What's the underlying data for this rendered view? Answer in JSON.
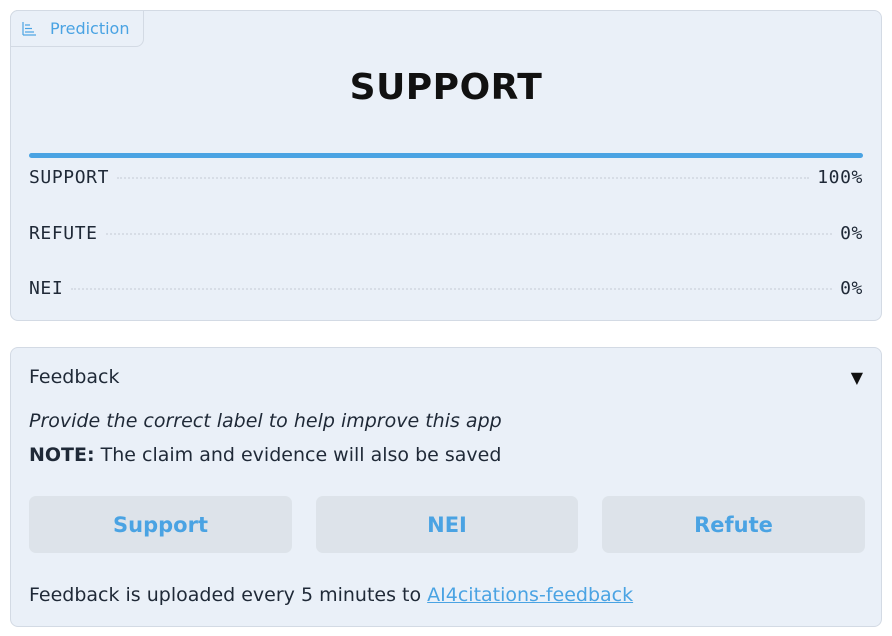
{
  "prediction": {
    "tab_label": "Prediction",
    "label": "SUPPORT",
    "confidences": [
      {
        "label": "SUPPORT",
        "value_text": "100%",
        "fraction": 1.0
      },
      {
        "label": "REFUTE",
        "value_text": "0%",
        "fraction": 0.0
      },
      {
        "label": "NEI",
        "value_text": "0%",
        "fraction": 0.0
      }
    ]
  },
  "feedback": {
    "title": "Feedback",
    "caret": "▼",
    "instruction": "Provide the correct label to help improve this app",
    "note_bold": "NOTE:",
    "note_text": " The claim and evidence will also be saved",
    "buttons": {
      "support": "Support",
      "nei": "NEI",
      "refute": "Refute"
    },
    "footer_text": "Feedback is uploaded every 5 minutes to ",
    "footer_link": "AI4citations-feedback"
  },
  "colors": {
    "accent": "#4aa3e3",
    "panel_bg": "#eaf0f8",
    "button_bg": "#dde3ea"
  },
  "icons": {
    "prediction_tab": "bar-chart-icon"
  }
}
